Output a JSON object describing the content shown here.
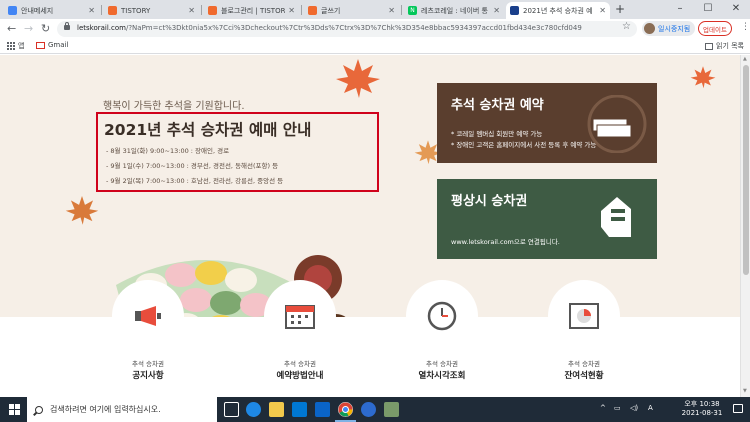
{
  "browser": {
    "tabs": [
      {
        "label": "안내메세지",
        "active": false,
        "favicon_color": "#4285f4"
      },
      {
        "label": "TISTORY",
        "active": false,
        "favicon_color": "#f06a2e"
      },
      {
        "label": "블로그관리 | TISTORY",
        "active": false,
        "favicon_color": "#f06a2e"
      },
      {
        "label": "글쓰기",
        "active": false,
        "favicon_color": "#f06a2e"
      },
      {
        "label": "레츠코레일 : 네이버 통",
        "active": false,
        "favicon_color": "#03c75a",
        "favicon_glyph": "N"
      },
      {
        "label": "2021년 추석 승차권 예",
        "active": true,
        "favicon_color": "#1a3f8b"
      }
    ],
    "new_tab_glyph": "+",
    "window_controls": [
      "–",
      "☐",
      "✕"
    ],
    "url_host": "letskorail.com",
    "url_path": "/?NaPm=ct%3Dkt0nia5x%7Cci%3Dcheckout%7Ctr%3Dds%7Ctrx%3D%7Chk%3D354e8bbac5934397accd01fbd434e3c780cfd049",
    "profile_label": "일시중지됨",
    "update_label": "업데이트",
    "bookmarks": {
      "apps_label": "앱",
      "gmail_label": "Gmail",
      "reading_list_label": "읽기 목록"
    }
  },
  "page": {
    "greeting": "행복이 가득한 추석을 기원합니다.",
    "notice": {
      "title": "2021년 추석 승차권 예매 안내",
      "lines": [
        "- 8월 31일(화) 9:00~13:00 : 장애인, 경로",
        "- 9월 1일(수) 7:00~13:00 : 경부선, 경전선, 동해선(포항) 등",
        "- 9월 2일(목) 7:00~13:00 : 호남선, 전라선, 강릉선, 중앙선 등"
      ]
    },
    "promo_reserve": {
      "title": "추석 승차권 예약",
      "lines": [
        "* 코레일 멤버십 회원만 예약 가능",
        "* 장애인 고객은 홈페이지에서 사전 등록 후 예약 가능"
      ]
    },
    "promo_regular": {
      "title": "평상시 승차권",
      "subtitle": "www.letskorail.com으로 연결됩니다."
    },
    "cards": [
      {
        "small": "추석 승차권",
        "label": "공지사항",
        "icon": "megaphone-icon"
      },
      {
        "small": "추석 승차권",
        "label": "예약방법안내",
        "icon": "calendar-icon"
      },
      {
        "small": "추석 승차권",
        "label": "열차시각조회",
        "icon": "clock-icon"
      },
      {
        "small": "추석 승차권",
        "label": "잔여석현황",
        "icon": "pie-chart-icon"
      }
    ],
    "colors": {
      "background": "#f6efe7",
      "notice_border": "#d0021b",
      "promo_brown": "#5a3e2e",
      "promo_green": "#3e5b44",
      "leaf_orange": "#e8683a"
    }
  },
  "taskbar": {
    "search_placeholder": "검색하려면 여기에 입력하십시오.",
    "clock_time": "오후 10:38",
    "clock_date": "2021-08-31",
    "tray_lang": "A"
  }
}
